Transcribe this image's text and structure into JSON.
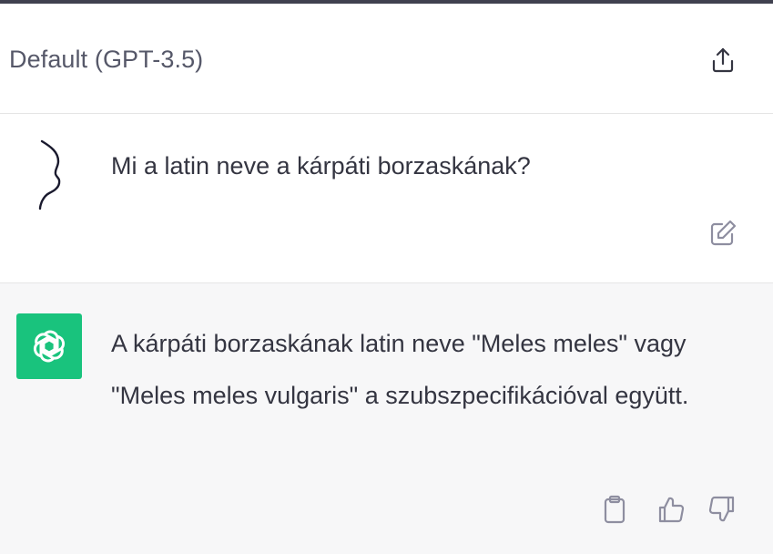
{
  "header": {
    "model_title": "Default (GPT-3.5)",
    "share_icon": "share-icon"
  },
  "conversation": {
    "user_message": {
      "text": "Mi a latin neve a kárpáti borzaskának?",
      "avatar_icon": "user-avatar-drawing",
      "edit_icon": "edit-icon"
    },
    "assistant_message": {
      "text": "A kárpáti borzaskának latin neve \"Meles meles\" vagy \"Meles meles vulgaris\" a szubszpecifikációval együtt.",
      "avatar_icon": "openai-logo-icon",
      "avatar_color": "#19c37d",
      "action_icons": [
        "copy-icon",
        "thumbs-up-icon",
        "thumbs-down-icon"
      ]
    }
  },
  "colors": {
    "assistant_bg": "#f7f7f8",
    "user_bg": "#ffffff",
    "text": "#343541",
    "muted_icon": "#8e8ea0"
  }
}
